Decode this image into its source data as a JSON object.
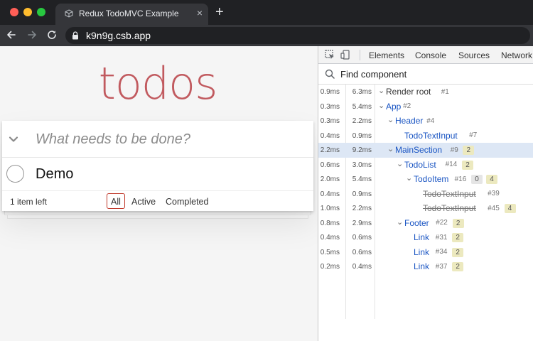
{
  "browser": {
    "tab_title": "Redux TodoMVC Example",
    "tab_close": "×",
    "new_tab": "+",
    "url": "k9n9g.csb.app"
  },
  "colors": {
    "traffic_close": "#ff5f57",
    "traffic_minimize": "#febc2e",
    "traffic_maximize": "#28c840",
    "todos_title": "#b83f45",
    "link_blue": "#1a55c3",
    "selected_row": "#dde7f5",
    "badge": "#ece9bf"
  },
  "app": {
    "title": "todos",
    "new_todo_placeholder": "What needs to be done?",
    "todos": [
      {
        "label": "Demo",
        "completed": false
      }
    ],
    "items_left": "1 item left",
    "filters": [
      "All",
      "Active",
      "Completed"
    ],
    "selected_filter": "All"
  },
  "devtools": {
    "tabs": [
      "Elements",
      "Console",
      "Sources",
      "Network"
    ],
    "search_placeholder": "Find component",
    "tree": [
      {
        "t1": "0.9ms",
        "t2": "6.3ms",
        "caret": "⌄",
        "name": "Render root",
        "key": "#1",
        "root": true
      },
      {
        "t1": "0.3ms",
        "t2": "5.4ms",
        "caret": "⌄",
        "name": "App",
        "key": "#2"
      },
      {
        "t1": "0.3ms",
        "t2": "2.2ms",
        "caret": "⌄",
        "name": "Header",
        "key": "#4"
      },
      {
        "t1": "0.4ms",
        "t2": "0.9ms",
        "caret": "",
        "name": "TodoTextInput",
        "key": "#7"
      },
      {
        "t1": "2.2ms",
        "t2": "9.2ms",
        "caret": "⌄",
        "name": "MainSection",
        "key": "#9",
        "badge": "2",
        "selected": true
      },
      {
        "t1": "0.6ms",
        "t2": "3.0ms",
        "caret": "⌄",
        "name": "TodoList",
        "key": "#14",
        "badge": "2"
      },
      {
        "t1": "2.0ms",
        "t2": "5.4ms",
        "caret": "⌄",
        "name": "TodoItem",
        "key": "#16",
        "badge0": "0",
        "badge": "4"
      },
      {
        "t1": "0.4ms",
        "t2": "0.9ms",
        "caret": "",
        "name": "TodoTextInput",
        "key": "#39",
        "filtered": true
      },
      {
        "t1": "1.0ms",
        "t2": "2.2ms",
        "caret": "",
        "name": "TodoTextInput",
        "key": "#45",
        "filtered": true,
        "badge": "4"
      },
      {
        "t1": "0.8ms",
        "t2": "2.9ms",
        "caret": "⌄",
        "name": "Footer",
        "key": "#22",
        "badge": "2"
      },
      {
        "t1": "0.4ms",
        "t2": "0.6ms",
        "caret": "",
        "name": "Link",
        "key": "#31",
        "badge": "2"
      },
      {
        "t1": "0.5ms",
        "t2": "0.6ms",
        "caret": "",
        "name": "Link",
        "key": "#34",
        "badge": "2"
      },
      {
        "t1": "0.2ms",
        "t2": "0.4ms",
        "caret": "",
        "name": "Link",
        "key": "#37",
        "badge": "2"
      }
    ]
  }
}
